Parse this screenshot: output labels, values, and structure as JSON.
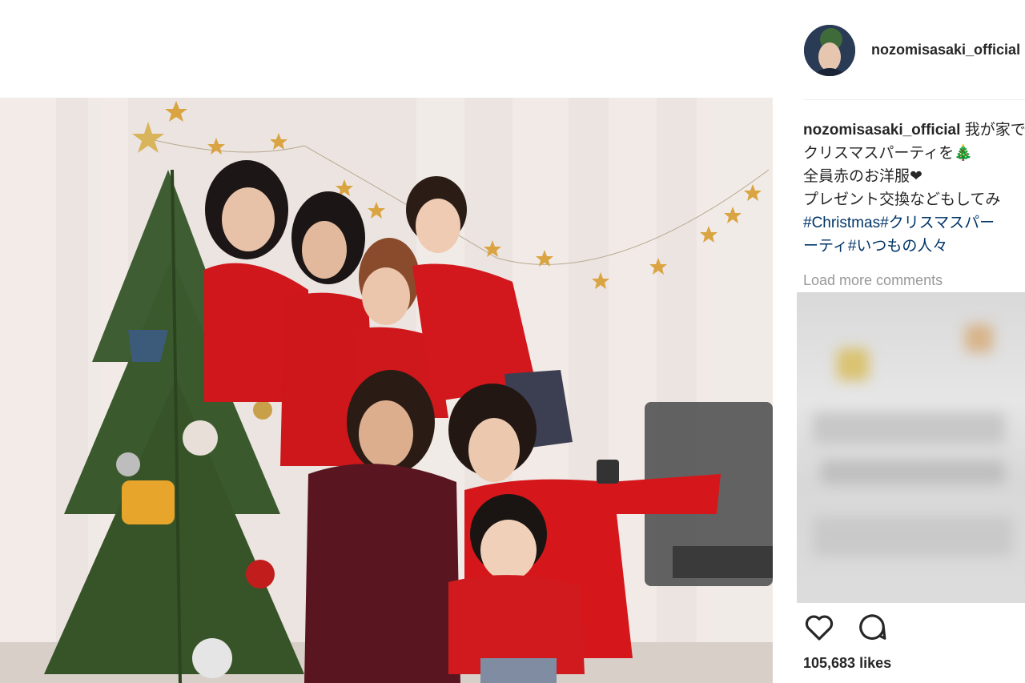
{
  "post": {
    "username": "nozomisasaki_official",
    "caption_lines": [
      "我が家で",
      "クリスマスパーティを🎄",
      "全員赤のお洋服❤",
      "プレゼント交換などもしてみ"
    ],
    "hashtag_lines": [
      "#Christmas#クリスマスパー",
      "ーティ#いつもの人々"
    ],
    "load_more": "Load more comments",
    "likes": "105,683 likes"
  },
  "icons": {
    "like": "heart-outline-icon",
    "comment": "comment-bubble-icon"
  },
  "colors": {
    "red_sweater": "#d0171b",
    "tree_green": "#3d5a2f",
    "hashtag": "#003569"
  }
}
